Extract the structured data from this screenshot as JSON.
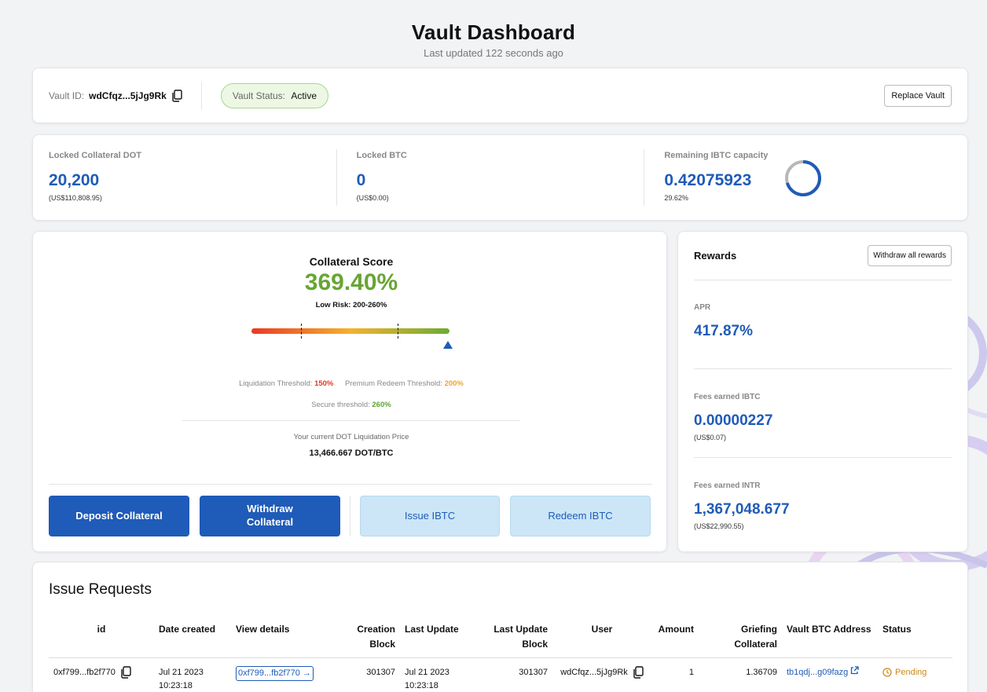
{
  "header": {
    "title": "Vault Dashboard",
    "subtitle": "Last updated 122 seconds ago"
  },
  "vault": {
    "id_label": "Vault ID:",
    "id_value": "wdCfqz...5jJg9Rk",
    "status_label": "Vault Status:",
    "status_value": "Active",
    "replace_button": "Replace Vault"
  },
  "stats": [
    {
      "label": "Locked Collateral DOT",
      "value": "20,200",
      "sub": "(US$110,808.95)"
    },
    {
      "label": "Locked BTC",
      "value": "0",
      "sub": "(US$0.00)"
    },
    {
      "label": "Remaining IBTC capacity",
      "value": "0.42075923",
      "sub": "29.62%",
      "capacity_fraction": 0.2962
    }
  ],
  "score": {
    "title": "Collateral Score",
    "value": "369.40%",
    "risk": "Low Risk: 200-260%",
    "liquidation_label": "Liquidation Threshold:",
    "liquidation_value": "150%",
    "premium_label": "Premium Redeem Threshold:",
    "premium_value": "200%",
    "secure_label": "Secure threshold:",
    "secure_value": "260%",
    "liq_price_label": "Your current DOT Liquidation Price",
    "liq_price_value": "13,466.667 DOT/BTC"
  },
  "actions": {
    "deposit": "Deposit Collateral",
    "withdraw": "Withdraw Collateral",
    "issue": "Issue IBTC",
    "redeem": "Redeem IBTC"
  },
  "rewards": {
    "title": "Rewards",
    "withdraw_button": "Withdraw all rewards",
    "apr_label": "APR",
    "apr_value": "417.87%",
    "ibtc_label": "Fees earned IBTC",
    "ibtc_value": "0.00000227",
    "ibtc_sub": "(US$0.07)",
    "intr_label": "Fees earned INTR",
    "intr_value": "1,367,048.677",
    "intr_sub": "(US$22,990.55)"
  },
  "issues": {
    "title": "Issue Requests",
    "columns": [
      "id",
      "Date created",
      "View details",
      "Creation Block",
      "Last Update",
      "Last Update Block",
      "User",
      "Amount",
      "Griefing Collateral",
      "Vault BTC Address",
      "Status"
    ],
    "rows": [
      {
        "id": "0xf799...fb2f770",
        "date_created": "Jul 21 2023 10:23:18",
        "view_details": "0xf799...fb2f770",
        "creation_block": "301307",
        "last_update": "Jul 21 2023 10:23:18",
        "last_update_block": "301307",
        "user": "wdCfqz...5jJg9Rk",
        "amount": "1",
        "griefing": "1.36709",
        "btc_address": "tb1qdj...g09fazg",
        "status": "Pending"
      }
    ]
  },
  "colors": {
    "accent": "#1f5bb8",
    "score_green": "#68a534",
    "status_pending": "#c88a18"
  }
}
